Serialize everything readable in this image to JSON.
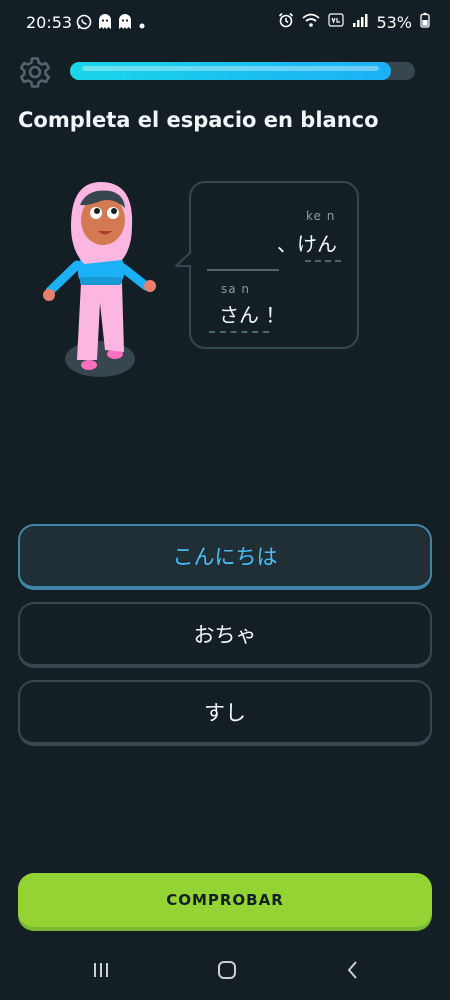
{
  "status_bar": {
    "time": "20:53",
    "battery": "53%",
    "icons_left": [
      "whatsapp-icon",
      "ghost-icon",
      "ghost-icon",
      "dot-icon"
    ],
    "icons_right": [
      "alarm-icon",
      "wifi-icon",
      "volte-icon",
      "signal-icon",
      "battery-icon"
    ]
  },
  "header": {
    "settings_icon": "gear-icon",
    "progress_percent": 93,
    "progress_color": "#1cb0f6"
  },
  "exercise": {
    "title": "Completa el espacio en blanco",
    "sentence": {
      "line1": {
        "romaji": "ke  n",
        "kana": "、けん"
      },
      "line2": {
        "romaji": "sa  n",
        "kana": "さん ！"
      }
    }
  },
  "options": [
    {
      "label": "こんにちは",
      "selected": true
    },
    {
      "label": "おちゃ",
      "selected": false
    },
    {
      "label": "すし",
      "selected": false
    }
  ],
  "check_button": {
    "label": "COMPROBAR",
    "color": "#93d333"
  },
  "nav_bar": {
    "items": [
      "recent-apps-icon",
      "home-icon",
      "back-icon"
    ]
  }
}
